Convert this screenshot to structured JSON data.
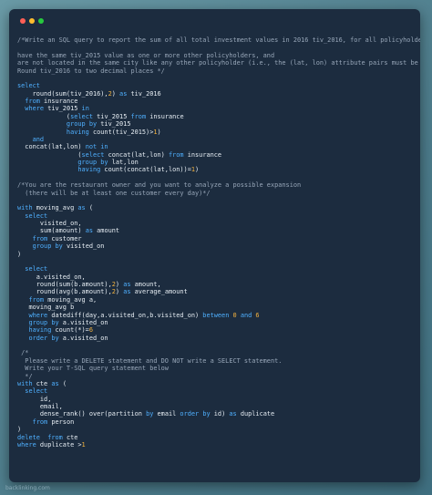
{
  "window": {
    "buttons": [
      "close",
      "minimize",
      "maximize"
    ]
  },
  "code_lines": [
    [
      [
        "c",
        "/*Write an SQL query to report the sum of all total investment values in 2016 tiv_2016, for all policyholders who:"
      ]
    ],
    [],
    [
      [
        "c",
        "have the same tiv_2015 value as one or more other policyholders, and"
      ]
    ],
    [
      [
        "c",
        "are not located in the same city like any other policyholder (i.e., the (lat, lon) attribute pairs must be unique)."
      ]
    ],
    [
      [
        "c",
        "Round tiv_2016 to two decimal places */"
      ]
    ],
    [],
    [
      [
        "k",
        "select"
      ]
    ],
    [
      [
        "t",
        "    round(sum(tiv_2016),"
      ],
      [
        "n",
        "2"
      ],
      [
        "t",
        ") "
      ],
      [
        "k",
        "as"
      ],
      [
        "t",
        " tiv_2016"
      ]
    ],
    [
      [
        "k",
        "  from"
      ],
      [
        "t",
        " insurance"
      ]
    ],
    [
      [
        "k",
        "  where"
      ],
      [
        "t",
        " tiv_2015 "
      ],
      [
        "k",
        "in"
      ]
    ],
    [
      [
        "t",
        "             ("
      ],
      [
        "k",
        "select"
      ],
      [
        "t",
        " tiv_2015 "
      ],
      [
        "k",
        "from"
      ],
      [
        "t",
        " insurance"
      ]
    ],
    [
      [
        "k",
        "             group by"
      ],
      [
        "t",
        " tiv_2015"
      ]
    ],
    [
      [
        "k",
        "             having"
      ],
      [
        "t",
        " count(tiv_2015)>"
      ],
      [
        "n",
        "1"
      ],
      [
        "t",
        ")"
      ]
    ],
    [
      [
        "k",
        "    and"
      ]
    ],
    [
      [
        "t",
        "  concat(lat,lon) "
      ],
      [
        "k",
        "not in"
      ]
    ],
    [
      [
        "t",
        "                ("
      ],
      [
        "k",
        "select"
      ],
      [
        "t",
        " concat(lat,lon) "
      ],
      [
        "k",
        "from"
      ],
      [
        "t",
        " insurance"
      ]
    ],
    [
      [
        "k",
        "                group by"
      ],
      [
        "t",
        " lat,lon"
      ]
    ],
    [
      [
        "k",
        "                having"
      ],
      [
        "t",
        " count(concat(lat,lon))="
      ],
      [
        "n",
        "1"
      ],
      [
        "t",
        ")"
      ]
    ],
    [],
    [
      [
        "c",
        "/*You are the restaurant owner and you want to analyze a possible expansion"
      ]
    ],
    [
      [
        "c",
        "  (there will be at least one customer every day)*/"
      ]
    ],
    [],
    [
      [
        "k",
        "with"
      ],
      [
        "t",
        " moving_avg "
      ],
      [
        "k",
        "as"
      ],
      [
        "t",
        " ("
      ]
    ],
    [
      [
        "k",
        "  select"
      ]
    ],
    [
      [
        "t",
        "      visited_on,"
      ]
    ],
    [
      [
        "t",
        "      sum(amount) "
      ],
      [
        "k",
        "as"
      ],
      [
        "t",
        " amount"
      ]
    ],
    [
      [
        "k",
        "    from"
      ],
      [
        "t",
        " customer"
      ]
    ],
    [
      [
        "k",
        "    group by"
      ],
      [
        "t",
        " visited_on"
      ]
    ],
    [
      [
        "t",
        ")"
      ]
    ],
    [],
    [
      [
        "k",
        "  select"
      ]
    ],
    [
      [
        "t",
        "     a.visited_on,"
      ]
    ],
    [
      [
        "t",
        "     round(sum(b.amount),"
      ],
      [
        "n",
        "2"
      ],
      [
        "t",
        ") "
      ],
      [
        "k",
        "as"
      ],
      [
        "t",
        " amount,"
      ]
    ],
    [
      [
        "t",
        "     round(avg(b.amount),"
      ],
      [
        "n",
        "2"
      ],
      [
        "t",
        ") "
      ],
      [
        "k",
        "as"
      ],
      [
        "t",
        " average_amount"
      ]
    ],
    [
      [
        "k",
        "   from"
      ],
      [
        "t",
        " moving_avg a,"
      ]
    ],
    [
      [
        "t",
        "   moving_avg b"
      ]
    ],
    [
      [
        "k",
        "   where"
      ],
      [
        "t",
        " datediff(day,a.visited_on,b.visited_on) "
      ],
      [
        "k",
        "between"
      ],
      [
        "t",
        " "
      ],
      [
        "n",
        "0"
      ],
      [
        "t",
        " "
      ],
      [
        "k",
        "and"
      ],
      [
        "t",
        " "
      ],
      [
        "n",
        "6"
      ]
    ],
    [
      [
        "k",
        "   group by"
      ],
      [
        "t",
        " a.visited_on"
      ]
    ],
    [
      [
        "k",
        "   having"
      ],
      [
        "t",
        " count(*)="
      ],
      [
        "n",
        "6"
      ]
    ],
    [
      [
        "k",
        "   order by"
      ],
      [
        "t",
        " a.visited_on"
      ]
    ],
    [],
    [
      [
        "c",
        " /*"
      ]
    ],
    [
      [
        "c",
        "  Please write a DELETE statement and DO NOT write a SELECT statement."
      ]
    ],
    [
      [
        "c",
        "  Write your T-SQL query statement below"
      ]
    ],
    [
      [
        "c",
        "  */"
      ]
    ],
    [
      [
        "k",
        "with"
      ],
      [
        "t",
        " cte "
      ],
      [
        "k",
        "as"
      ],
      [
        "t",
        " ("
      ]
    ],
    [
      [
        "k",
        "  select"
      ]
    ],
    [
      [
        "t",
        "      id,"
      ]
    ],
    [
      [
        "t",
        "      email,"
      ]
    ],
    [
      [
        "t",
        "      dense_rank() over(partition "
      ],
      [
        "k",
        "by"
      ],
      [
        "t",
        " email "
      ],
      [
        "k",
        "order by"
      ],
      [
        "t",
        " id) "
      ],
      [
        "k",
        "as"
      ],
      [
        "t",
        " duplicate"
      ]
    ],
    [
      [
        "k",
        "    from"
      ],
      [
        "t",
        " person"
      ]
    ],
    [
      [
        "t",
        ")"
      ]
    ],
    [
      [
        "k",
        "delete"
      ],
      [
        "t",
        "  "
      ],
      [
        "k",
        "from"
      ],
      [
        "t",
        " cte"
      ]
    ],
    [
      [
        "k",
        "where"
      ],
      [
        "t",
        " duplicate >"
      ],
      [
        "n",
        "1"
      ]
    ]
  ],
  "colors": {
    "background": "#5b8a98",
    "editor": "#1c2c3f",
    "keyword": "#4fb0ff",
    "comment": "#97a6b8",
    "number": "#f3b23f",
    "text": "#e6edf3"
  },
  "footer": {
    "watermark": "backlinking.com"
  }
}
